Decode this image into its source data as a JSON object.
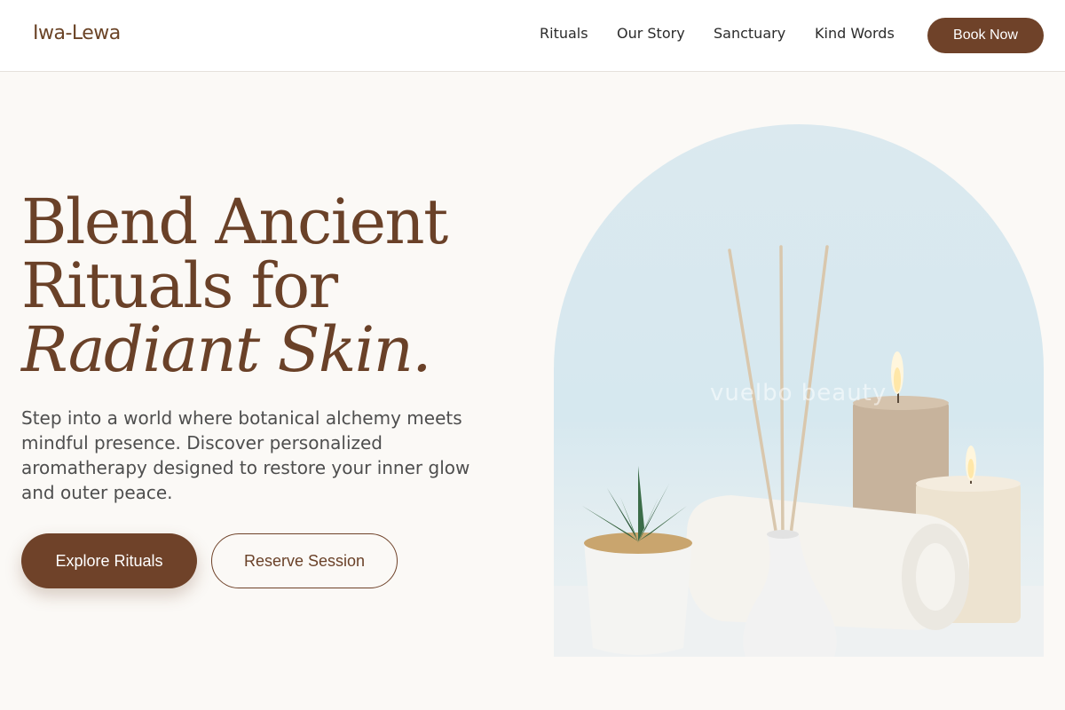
{
  "brand": {
    "name": "Iwa-Lewa"
  },
  "nav": {
    "items": [
      {
        "label": "Rituals"
      },
      {
        "label": "Our Story"
      },
      {
        "label": "Sanctuary"
      },
      {
        "label": "Kind Words"
      }
    ],
    "cta_label": "Book Now"
  },
  "hero": {
    "headline_line1": "Blend Ancient",
    "headline_line2": "Rituals for",
    "headline_line3": "Radiant Skin.",
    "description": "Step into a world where botanical alchemy meets mindful presence. Discover personalized aromatherapy designed to restore your inner glow and outer peace.",
    "primary_button": "Explore Rituals",
    "secondary_button": "Reserve Session",
    "image": {
      "watermark": "vuelbo beauty"
    }
  },
  "colors": {
    "brand": "#6f4229",
    "background": "#fbf9f6",
    "header_bg": "#ffffff"
  }
}
